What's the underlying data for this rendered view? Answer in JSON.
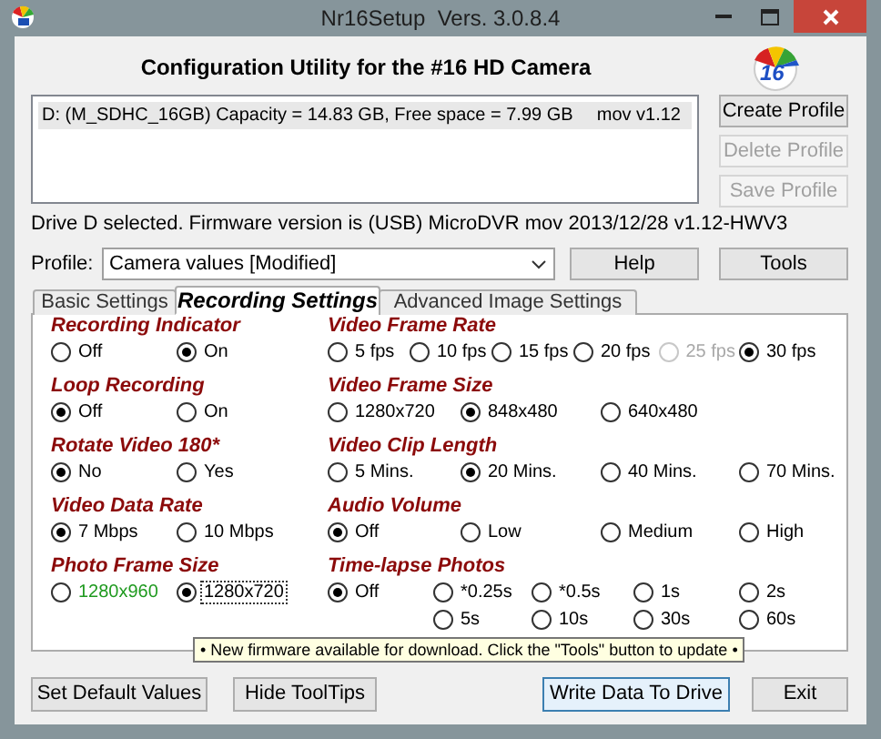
{
  "window": {
    "title": "Nr16Setup  Vers. 3.0.8.4"
  },
  "header": "Configuration Utility for the #16 HD Camera",
  "logo": {
    "text": "16"
  },
  "drives": [
    {
      "text": "D: (M_SDHC_16GB) Capacity = 14.83 GB, Free space = 7.99 GB",
      "version": "mov v1.12",
      "selected": true
    }
  ],
  "profile_buttons": [
    {
      "label": "Create Profile",
      "disabled": false
    },
    {
      "label": "Delete Profile",
      "disabled": true
    },
    {
      "label": "Save Profile",
      "disabled": true
    }
  ],
  "status": "Drive D selected. Firmware version is (USB) MicroDVR mov 2013/12/28 v1.12-HWV3",
  "profile": {
    "label": "Profile:",
    "value": "Camera values [Modified]"
  },
  "help_button": "Help",
  "tools_button": "Tools",
  "tabs": [
    {
      "label": "Basic Settings",
      "selected": false
    },
    {
      "label": "Recording Settings",
      "selected": true
    },
    {
      "label": "Advanced Image Settings",
      "selected": false
    }
  ],
  "rows": [
    {
      "left": {
        "title": "Recording Indicator",
        "kind": "pair",
        "options": [
          {
            "label": "Off",
            "selected": false
          },
          {
            "label": "On",
            "selected": true
          }
        ]
      },
      "right": {
        "title": "Video Frame Rate",
        "kind": "fps",
        "options": [
          {
            "label": "5 fps",
            "selected": false,
            "disabled": false
          },
          {
            "label": "10 fps",
            "selected": false,
            "disabled": false
          },
          {
            "label": "15 fps",
            "selected": false,
            "disabled": false
          },
          {
            "label": "20 fps",
            "selected": false,
            "disabled": false
          },
          {
            "label": "25 fps",
            "selected": false,
            "disabled": true
          },
          {
            "label": "30 fps",
            "selected": true,
            "disabled": false
          }
        ]
      }
    },
    {
      "left": {
        "title": "Loop Recording",
        "kind": "pair",
        "options": [
          {
            "label": "Off",
            "selected": true
          },
          {
            "label": "On",
            "selected": false
          }
        ]
      },
      "right": {
        "title": "Video Frame Size",
        "kind": "wide",
        "options": [
          {
            "label": "1280x720",
            "selected": false
          },
          {
            "label": "848x480",
            "selected": true
          },
          {
            "label": "640x480",
            "selected": false
          }
        ]
      }
    },
    {
      "left": {
        "title": "Rotate Video 180*",
        "kind": "pair",
        "options": [
          {
            "label": "No",
            "selected": true
          },
          {
            "label": "Yes",
            "selected": false
          }
        ]
      },
      "right": {
        "title": "Video Clip Length",
        "kind": "wide",
        "options": [
          {
            "label": "5 Mins.",
            "selected": false
          },
          {
            "label": "20 Mins.",
            "selected": true
          },
          {
            "label": "40 Mins.",
            "selected": false
          },
          {
            "label": "70 Mins.",
            "selected": false
          }
        ]
      }
    },
    {
      "left": {
        "title": "Video Data Rate",
        "kind": "pair",
        "options": [
          {
            "label": "7 Mbps",
            "selected": true
          },
          {
            "label": "10 Mbps",
            "selected": false
          }
        ]
      },
      "right": {
        "title": "Audio Volume",
        "kind": "wide",
        "options": [
          {
            "label": "Off",
            "selected": true
          },
          {
            "label": "Low",
            "selected": false
          },
          {
            "label": "Medium",
            "selected": false
          },
          {
            "label": "High",
            "selected": false
          }
        ]
      }
    },
    {
      "left": {
        "title": "Photo Frame Size",
        "kind": "pair",
        "options": [
          {
            "label": "1280x960",
            "selected": false,
            "color": "#1f9a1f",
            "focused": false
          },
          {
            "label": "1280x720",
            "selected": true,
            "color": "#000000",
            "focused": true
          }
        ]
      },
      "right": {
        "title": "Time-lapse Photos",
        "kind": "grid",
        "options": [
          {
            "label": "Off",
            "selected": true
          },
          {
            "label": "*0.25s",
            "selected": false
          },
          {
            "label": "*0.5s",
            "selected": false
          },
          {
            "label": "1s",
            "selected": false
          },
          {
            "label": "2s",
            "selected": false
          },
          {
            "label": "5s",
            "selected": false
          },
          {
            "label": "10s",
            "selected": false
          },
          {
            "label": "30s",
            "selected": false
          },
          {
            "label": "60s",
            "selected": false
          }
        ]
      }
    }
  ],
  "tooltip": "• New firmware available for download. Click the \"Tools\" button to update •",
  "bottom_buttons": [
    {
      "label": "Set Default Values",
      "default": false
    },
    {
      "label": "Hide ToolTips",
      "default": false
    },
    {
      "label": "Write Data To Drive",
      "default": true
    },
    {
      "label": "Exit",
      "default": false
    }
  ]
}
